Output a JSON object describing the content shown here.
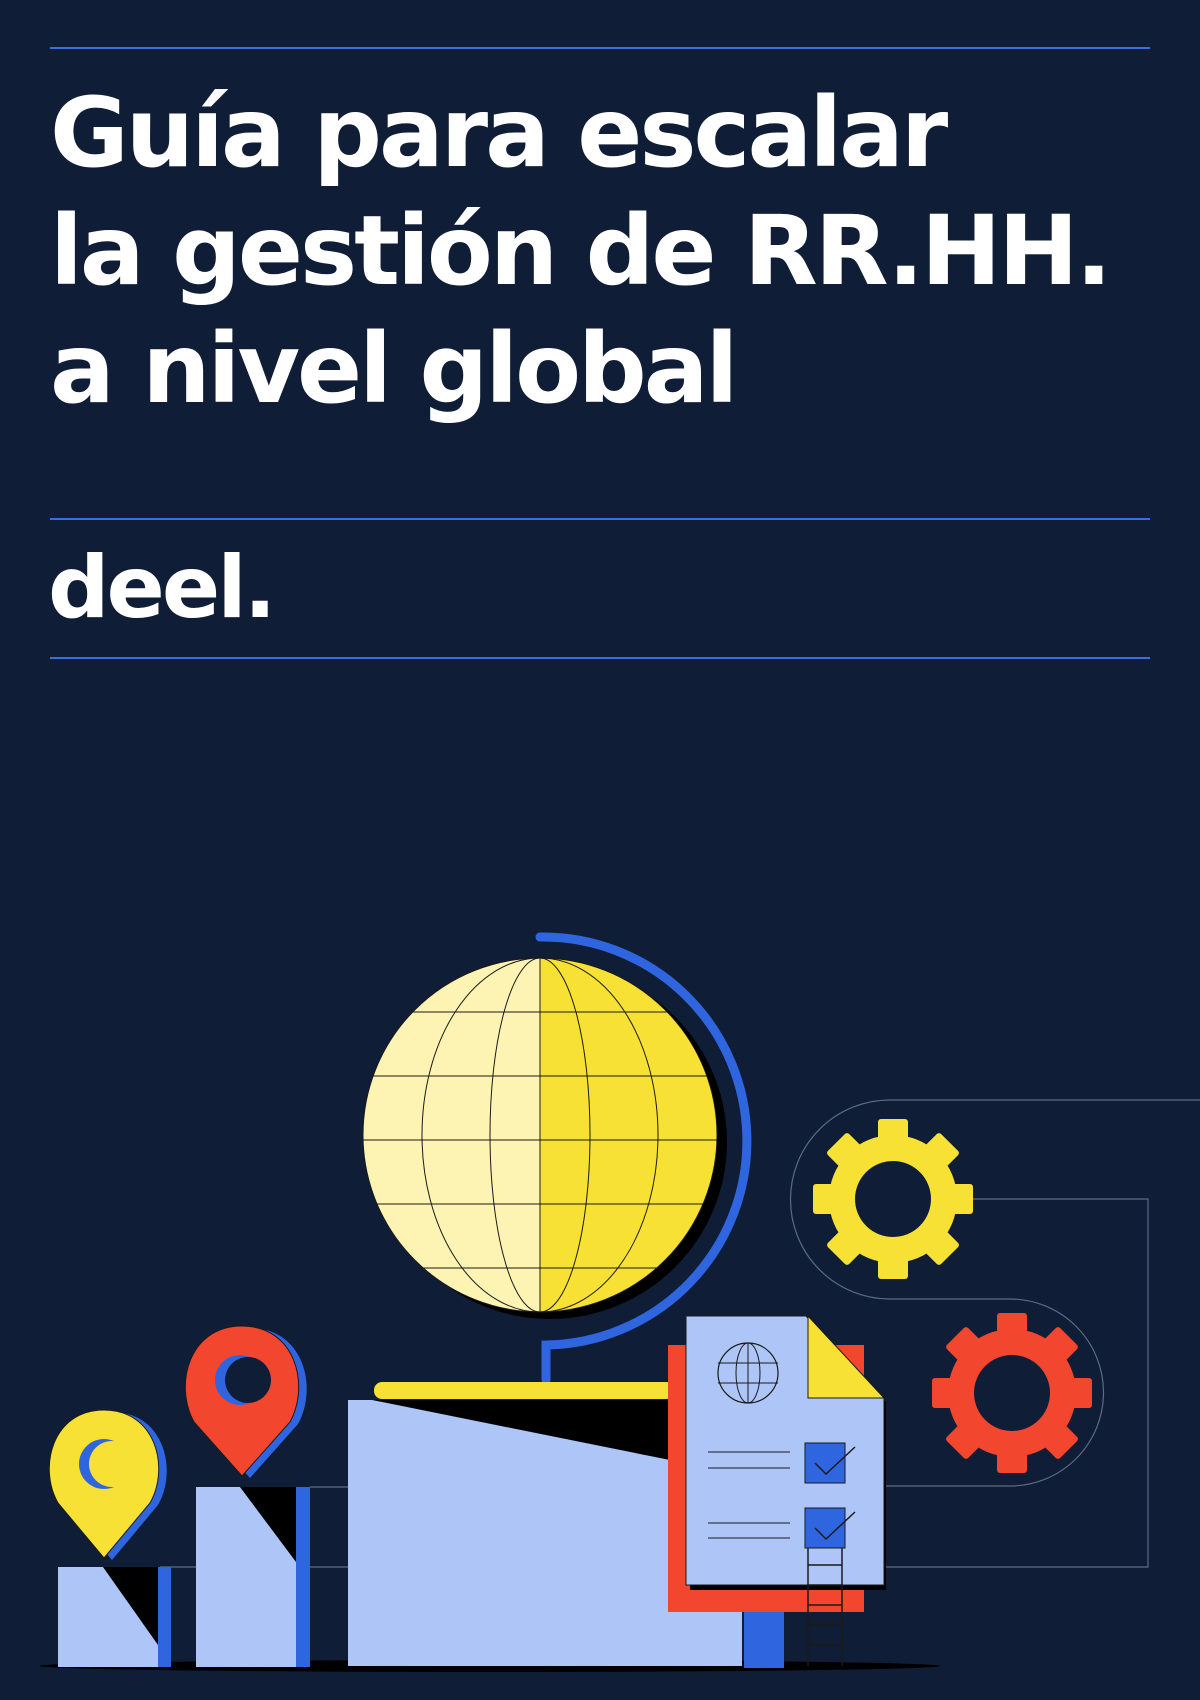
{
  "cover": {
    "title_lines": [
      "Guía para escalar",
      "la gestión de RR.HH.",
      "a nivel global"
    ],
    "logo": "deel."
  },
  "colors": {
    "background": "#0f1e36",
    "rule": "#3b6fe0",
    "yellow": "#f7e135",
    "pale_yellow": "#fdf3b3",
    "red": "#f3462f",
    "blue": "#2f66e0",
    "light_blue": "#aec5f7"
  },
  "icons": [
    "globe-icon",
    "gear-icon",
    "location-pin-icon",
    "checklist-document-icon"
  ]
}
